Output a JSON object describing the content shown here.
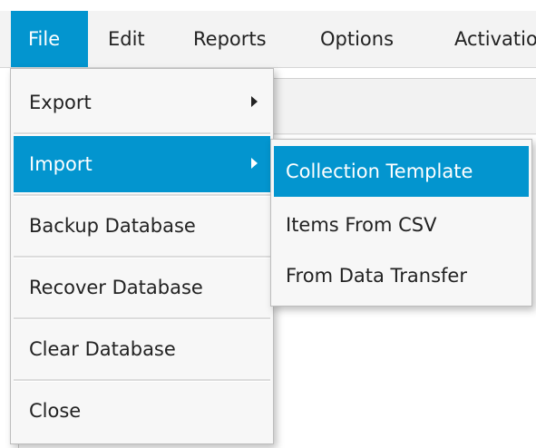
{
  "menubar": {
    "items": [
      {
        "label": "File"
      },
      {
        "label": "Edit"
      },
      {
        "label": "Reports"
      },
      {
        "label": "Options"
      },
      {
        "label": "Activation"
      }
    ]
  },
  "file_menu": {
    "items": [
      {
        "label": "Export",
        "has_submenu": true
      },
      {
        "label": "Import",
        "has_submenu": true,
        "highlighted": true
      },
      {
        "label": "Backup Database"
      },
      {
        "label": "Recover Database"
      },
      {
        "label": "Clear Database"
      },
      {
        "label": "Close"
      }
    ]
  },
  "import_submenu": {
    "items": [
      {
        "label": "Collection Template",
        "highlighted": true
      },
      {
        "label": "Items From CSV"
      },
      {
        "label": "From Data Transfer"
      }
    ]
  },
  "colors": {
    "accent": "#0395cf",
    "menu_background": "#f7f7f7",
    "menubar_background": "#f3f3f3"
  },
  "icons": {
    "submenu": "chevron-right-icon"
  }
}
